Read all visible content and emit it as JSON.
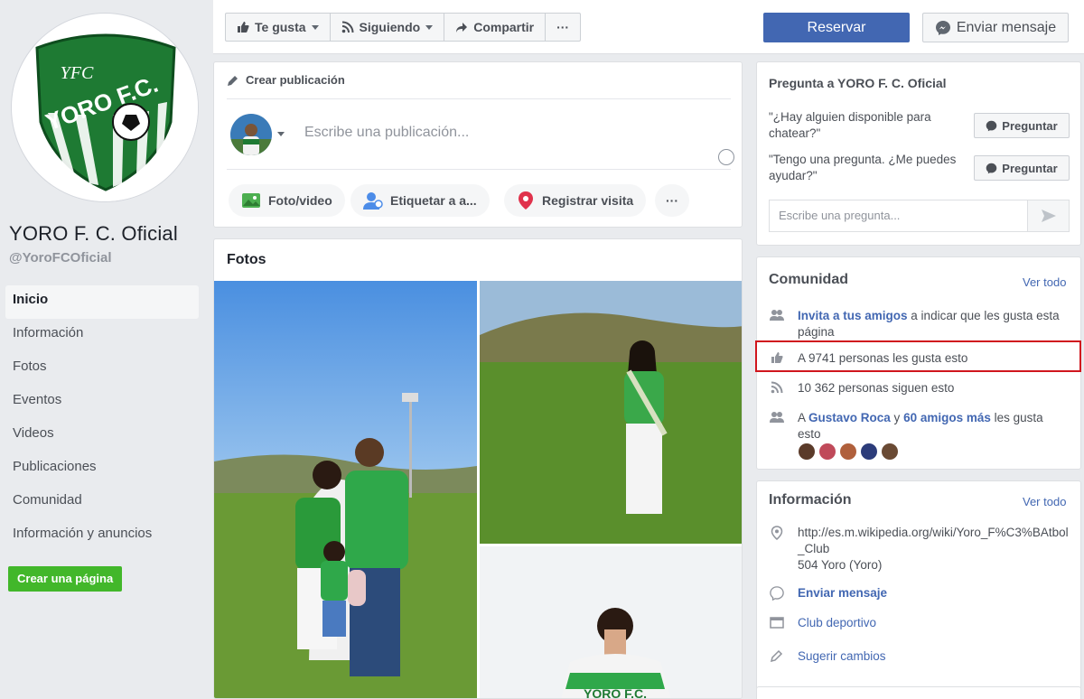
{
  "page": {
    "name": "YORO F. C. Oficial",
    "handle": "@YoroFCOficial",
    "logo_text": "YORO F.C.",
    "logo_monogram": "YFC"
  },
  "nav": [
    {
      "label": "Inicio",
      "active": true
    },
    {
      "label": "Información"
    },
    {
      "label": "Fotos"
    },
    {
      "label": "Eventos"
    },
    {
      "label": "Videos"
    },
    {
      "label": "Publicaciones"
    },
    {
      "label": "Comunidad"
    },
    {
      "label": "Información y anuncios"
    }
  ],
  "create_page_label": "Crear una página",
  "top_actions": {
    "like": "Te gusta",
    "following": "Siguiendo",
    "share": "Compartir",
    "more": "···",
    "reserve": "Reservar",
    "send_message": "Enviar mensaje"
  },
  "composer": {
    "title": "Crear publicación",
    "placeholder": "Escribe una publicación...",
    "photo_video": "Foto/video",
    "tag": "Etiquetar a a...",
    "checkin": "Registrar visita",
    "more": "···"
  },
  "photos": {
    "title": "Fotos"
  },
  "ask": {
    "title": "Pregunta a YORO F. C. Oficial",
    "questions": [
      {
        "text": "\"¿Hay alguien disponible para chatear?\"",
        "button": "Preguntar"
      },
      {
        "text": "\"Tengo una pregunta. ¿Me puedes ayudar?\"",
        "button": "Preguntar"
      }
    ],
    "input_placeholder": "Escribe una pregunta..."
  },
  "community": {
    "title": "Comunidad",
    "see_all": "Ver todo",
    "invite_link": "Invita a tus amigos",
    "invite_rest": " a indicar que les gusta esta página",
    "likes": "A 9741 personas les gusta esto",
    "followers": "10 362 personas siguen esto",
    "friends_prefix": "A ",
    "friend_name": "Gustavo Roca",
    "friends_mid": " y ",
    "friends_more": "60 amigos más",
    "friends_suffix": " les gusta esto"
  },
  "information": {
    "title": "Información",
    "see_all": "Ver todo",
    "url": "http://es.m.wikipedia.org/wiki/Yoro_F%C3%BAtbol_Club",
    "address": "504 Yoro (Yoro)",
    "send_message": "Enviar mensaje",
    "category": "Club deportivo",
    "suggest": "Sugerir cambios"
  },
  "colors": {
    "brand_blue": "#4267b2",
    "green": "#42b72a",
    "highlight_red": "#d0161e"
  }
}
